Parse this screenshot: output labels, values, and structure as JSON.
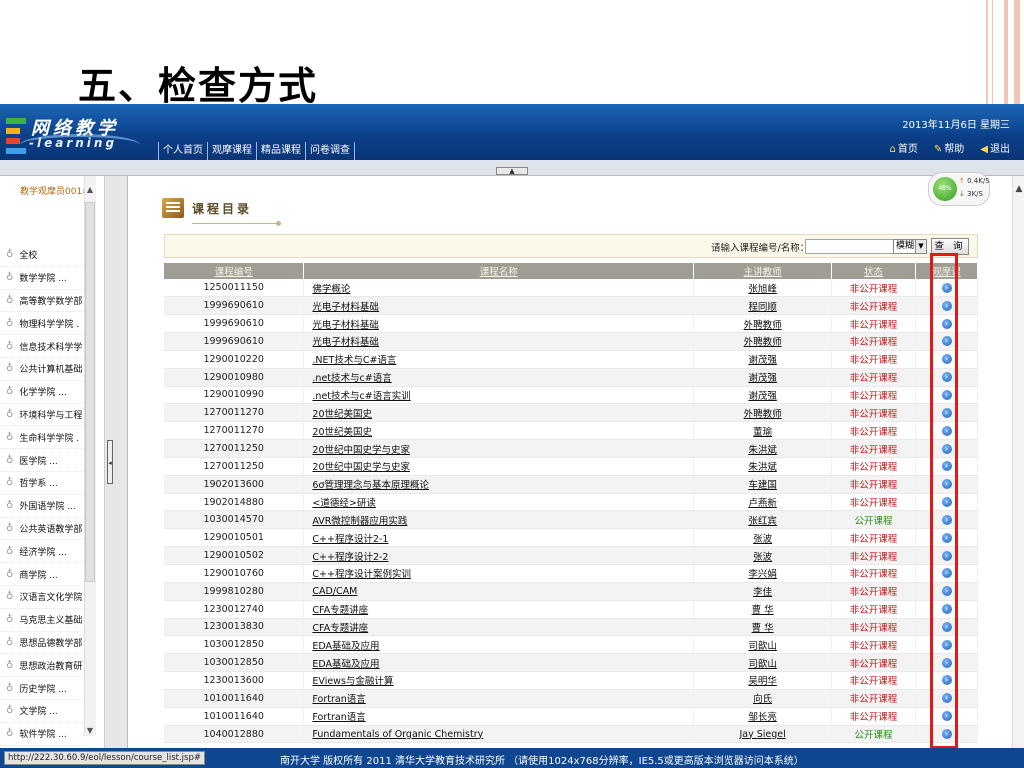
{
  "slide": {
    "title": "五、检查方式"
  },
  "app": {
    "logo_cn": "网络教学",
    "logo_en": "-learning",
    "date": "2013年11月6日 星期三",
    "nav": [
      "个人首页",
      "观摩课程",
      "精品课程",
      "问卷调查"
    ],
    "right_nav": {
      "home": "首页",
      "help": "帮助",
      "logout": "退出"
    }
  },
  "sidebar": {
    "user": "教学观摩员001›",
    "items": [
      "全校",
      "数学学院 ...",
      "高等教学数学部",
      "物理科学学院 .",
      "信息技术科学学",
      "公共计算机基础",
      "化学学院 ...",
      "环境科学与工程",
      "生命科学学院 .",
      "医学院 ...",
      "哲学系 ...",
      "外国语学院 ...",
      "公共英语教学部",
      "经济学院 ...",
      "商学院 ...",
      "汉语言文化学院",
      "马克思主义基础",
      "思想品德教学部",
      "思想政治教育研",
      "历史学院 ...",
      "文学院 ...",
      "软件学院 ..."
    ]
  },
  "speed": {
    "percent": "48%",
    "up": "0.4K/S",
    "down": "3K/S"
  },
  "catalog": {
    "title": "课程目录",
    "search_label": "请输入课程编号/名称：",
    "search_value": "",
    "mode": "模糊",
    "search_button": "查 询",
    "columns": [
      "课程编号",
      "课程名称",
      "主讲教师",
      "状态",
      "观摩课"
    ],
    "rows": [
      [
        "1250011150",
        "佛学概论",
        "张旭峰",
        "非公开课程"
      ],
      [
        "1999690610",
        "光电子材料基础",
        "程同顺",
        "非公开课程"
      ],
      [
        "1999690610",
        "光电子材料基础",
        "外聘教师",
        "非公开课程"
      ],
      [
        "1999690610",
        "光电子材料基础",
        "外聘教师",
        "非公开课程"
      ],
      [
        "1290010220",
        ".NET技术与C#语言",
        "谢茂强",
        "非公开课程"
      ],
      [
        "1290010980",
        ".net技术与c#语言",
        "谢茂强",
        "非公开课程"
      ],
      [
        "1290010990",
        ".net技术与c#语言实训",
        "谢茂强",
        "非公开课程"
      ],
      [
        "1270011270",
        "20世纪美国史",
        "外聘教师",
        "非公开课程"
      ],
      [
        "1270011270",
        "20世纪美国史",
        "董瑜",
        "非公开课程"
      ],
      [
        "1270011250",
        "20世纪中国史学与史家",
        "朱洪斌",
        "非公开课程"
      ],
      [
        "1270011250",
        "20世纪中国史学与史家",
        "朱洪斌",
        "非公开课程"
      ],
      [
        "1902013600",
        "6σ管理理念与基本原理概论",
        "车建国",
        "非公开课程"
      ],
      [
        "1902014880",
        "<道德经>研读",
        "卢燕新",
        "非公开课程"
      ],
      [
        "1030014570",
        "AVR微控制器应用实践",
        "张红宾",
        "公开课程"
      ],
      [
        "1290010501",
        "C++程序设计2-1",
        "张波",
        "非公开课程"
      ],
      [
        "1290010502",
        "C++程序设计2-2",
        "张波",
        "非公开课程"
      ],
      [
        "1290010760",
        "C++程序设计案例实训",
        "李兴娟",
        "非公开课程"
      ],
      [
        "1999810280",
        "CAD/CAM",
        "李佳",
        "非公开课程"
      ],
      [
        "1230012740",
        "CFA专题讲座",
        "曹 华",
        "非公开课程"
      ],
      [
        "1230013830",
        "CFA专题讲座",
        "曹 华",
        "非公开课程"
      ],
      [
        "1030012850",
        "EDA基础及应用",
        "司歆山",
        "非公开课程"
      ],
      [
        "1030012850",
        "EDA基础及应用",
        "司歆山",
        "非公开课程"
      ],
      [
        "1230013600",
        "EViews与金融计算",
        "吴明华",
        "非公开课程"
      ],
      [
        "1010011640",
        "Fortran语言",
        "向氏",
        "非公开课程"
      ],
      [
        "1010011640",
        "Fortran语言",
        "邹长亮",
        "非公开课程"
      ],
      [
        "1040012880",
        "Fundamentals of Organic Chemistry",
        "Jay Siegel",
        "公开课程"
      ]
    ]
  },
  "statusbar": {
    "url": "http://222.30.60.9/eol/lesson/course_list.jsp#",
    "footer": "南开大学 版权所有 2011 清华大学教育技术研究所 （请使用1024x768分辨率，IE5.5或更高版本浏览器访问本系统）"
  },
  "colors": {
    "header": "#0b3e86",
    "highlight": "#e11919",
    "private_status": "#c21a1a",
    "public_status": "#2c8a18"
  }
}
